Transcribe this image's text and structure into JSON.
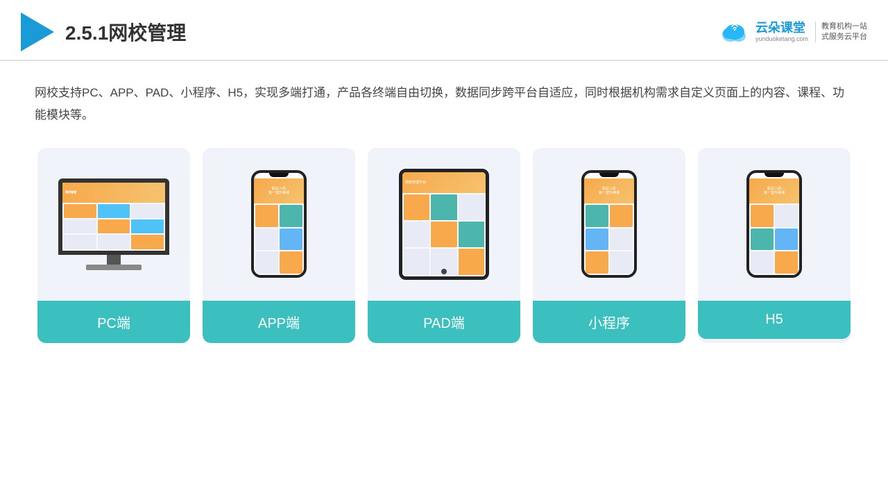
{
  "header": {
    "title": "2.5.1网校管理",
    "brand": {
      "name": "云朵课堂",
      "domain": "yunduoketang.com",
      "slogan": "教育机构一站\n式服务云平台"
    }
  },
  "description": "网校支持PC、APP、PAD、小程序、H5，实现多端打通，产品各终端自由切换，数据同步跨平台自适应，同时根据机构需求自定义页面上的内容、课程、功能模块等。",
  "devices": [
    {
      "id": "pc",
      "label": "PC端",
      "type": "pc"
    },
    {
      "id": "app",
      "label": "APP端",
      "type": "phone"
    },
    {
      "id": "pad",
      "label": "PAD端",
      "type": "tablet"
    },
    {
      "id": "miniprogram",
      "label": "小程序",
      "type": "phone"
    },
    {
      "id": "h5",
      "label": "H5",
      "type": "phone"
    }
  ],
  "colors": {
    "accent": "#3bbfbf",
    "header_line": "#e0e0e0",
    "triangle": "#1a9ad7",
    "card_bg": "#f0f4fa"
  }
}
